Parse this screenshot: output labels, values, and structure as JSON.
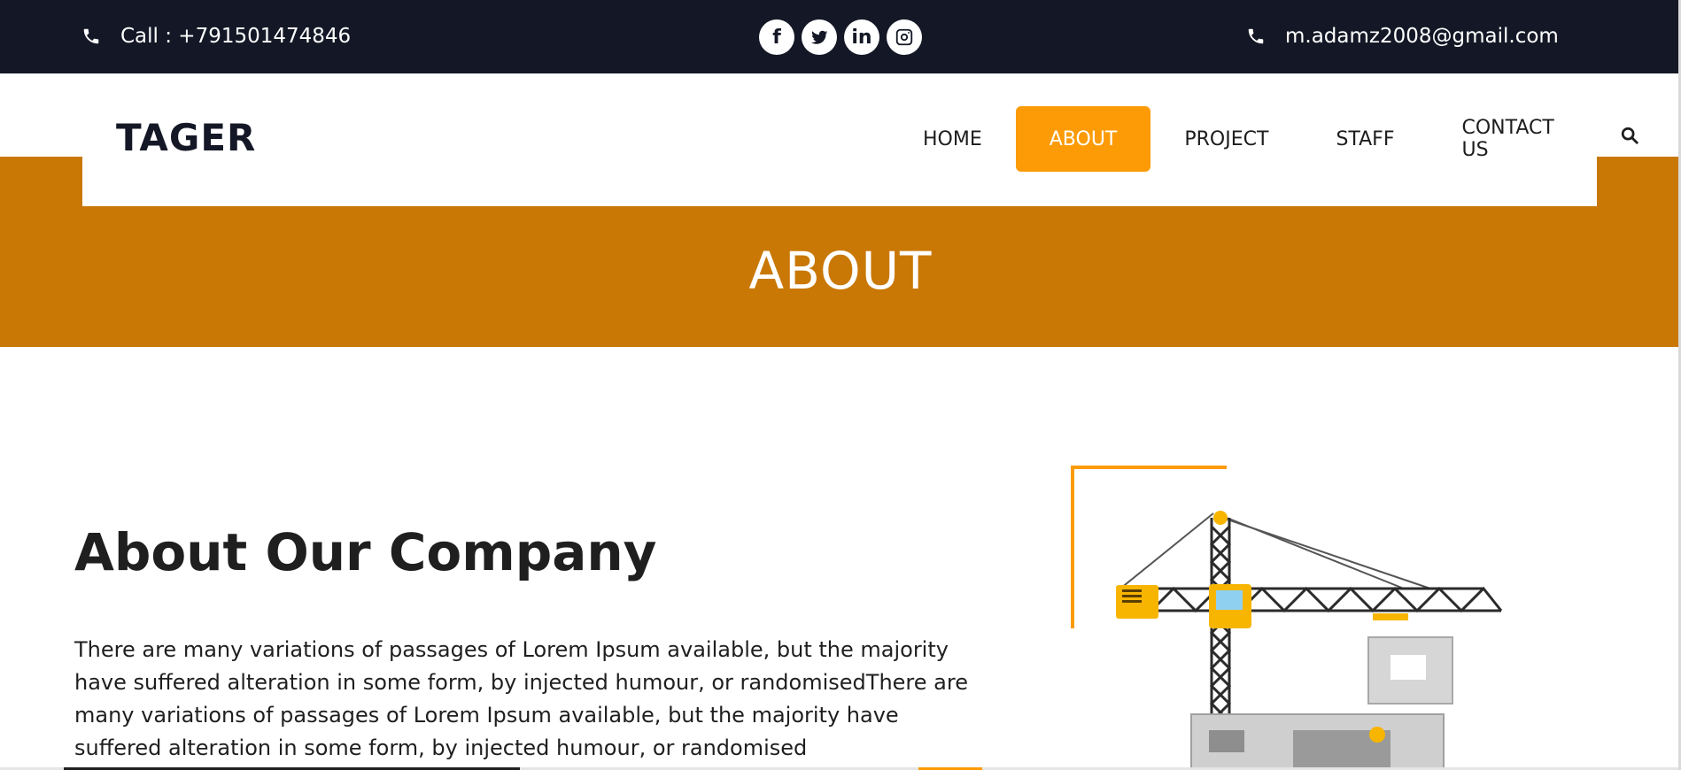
{
  "topbar": {
    "phone_text": "Call : +791501474846",
    "email_text": "m.adamz2008@gmail.com",
    "socials": [
      {
        "name": "facebook-icon",
        "glyph": "f"
      },
      {
        "name": "twitter-icon",
        "glyph": ""
      },
      {
        "name": "linkedin-icon",
        "glyph": "in"
      },
      {
        "name": "instagram-icon",
        "glyph": ""
      }
    ]
  },
  "brand": {
    "logo": "TAGER"
  },
  "nav": {
    "items": [
      {
        "label": "HOME",
        "active": false
      },
      {
        "label": "ABOUT",
        "active": true
      },
      {
        "label": "PROJECT",
        "active": false
      },
      {
        "label": "STAFF",
        "active": false
      },
      {
        "label": "CONTACT US",
        "active": false
      }
    ],
    "search_icon": "search-icon"
  },
  "hero": {
    "title": "ABOUT"
  },
  "about": {
    "heading": "About Our Company",
    "paragraph": "There are many variations of passages of Lorem Ipsum available, but the majority have suffered alteration in some form, by injected humour, or randomisedThere are many variations of passages of Lorem Ipsum available, but the majority have suffered alteration in some form, by injected humour, or randomised"
  },
  "colors": {
    "topbar_bg": "#141826",
    "hero_bg": "#c97805",
    "accent": "#fc9b05"
  }
}
